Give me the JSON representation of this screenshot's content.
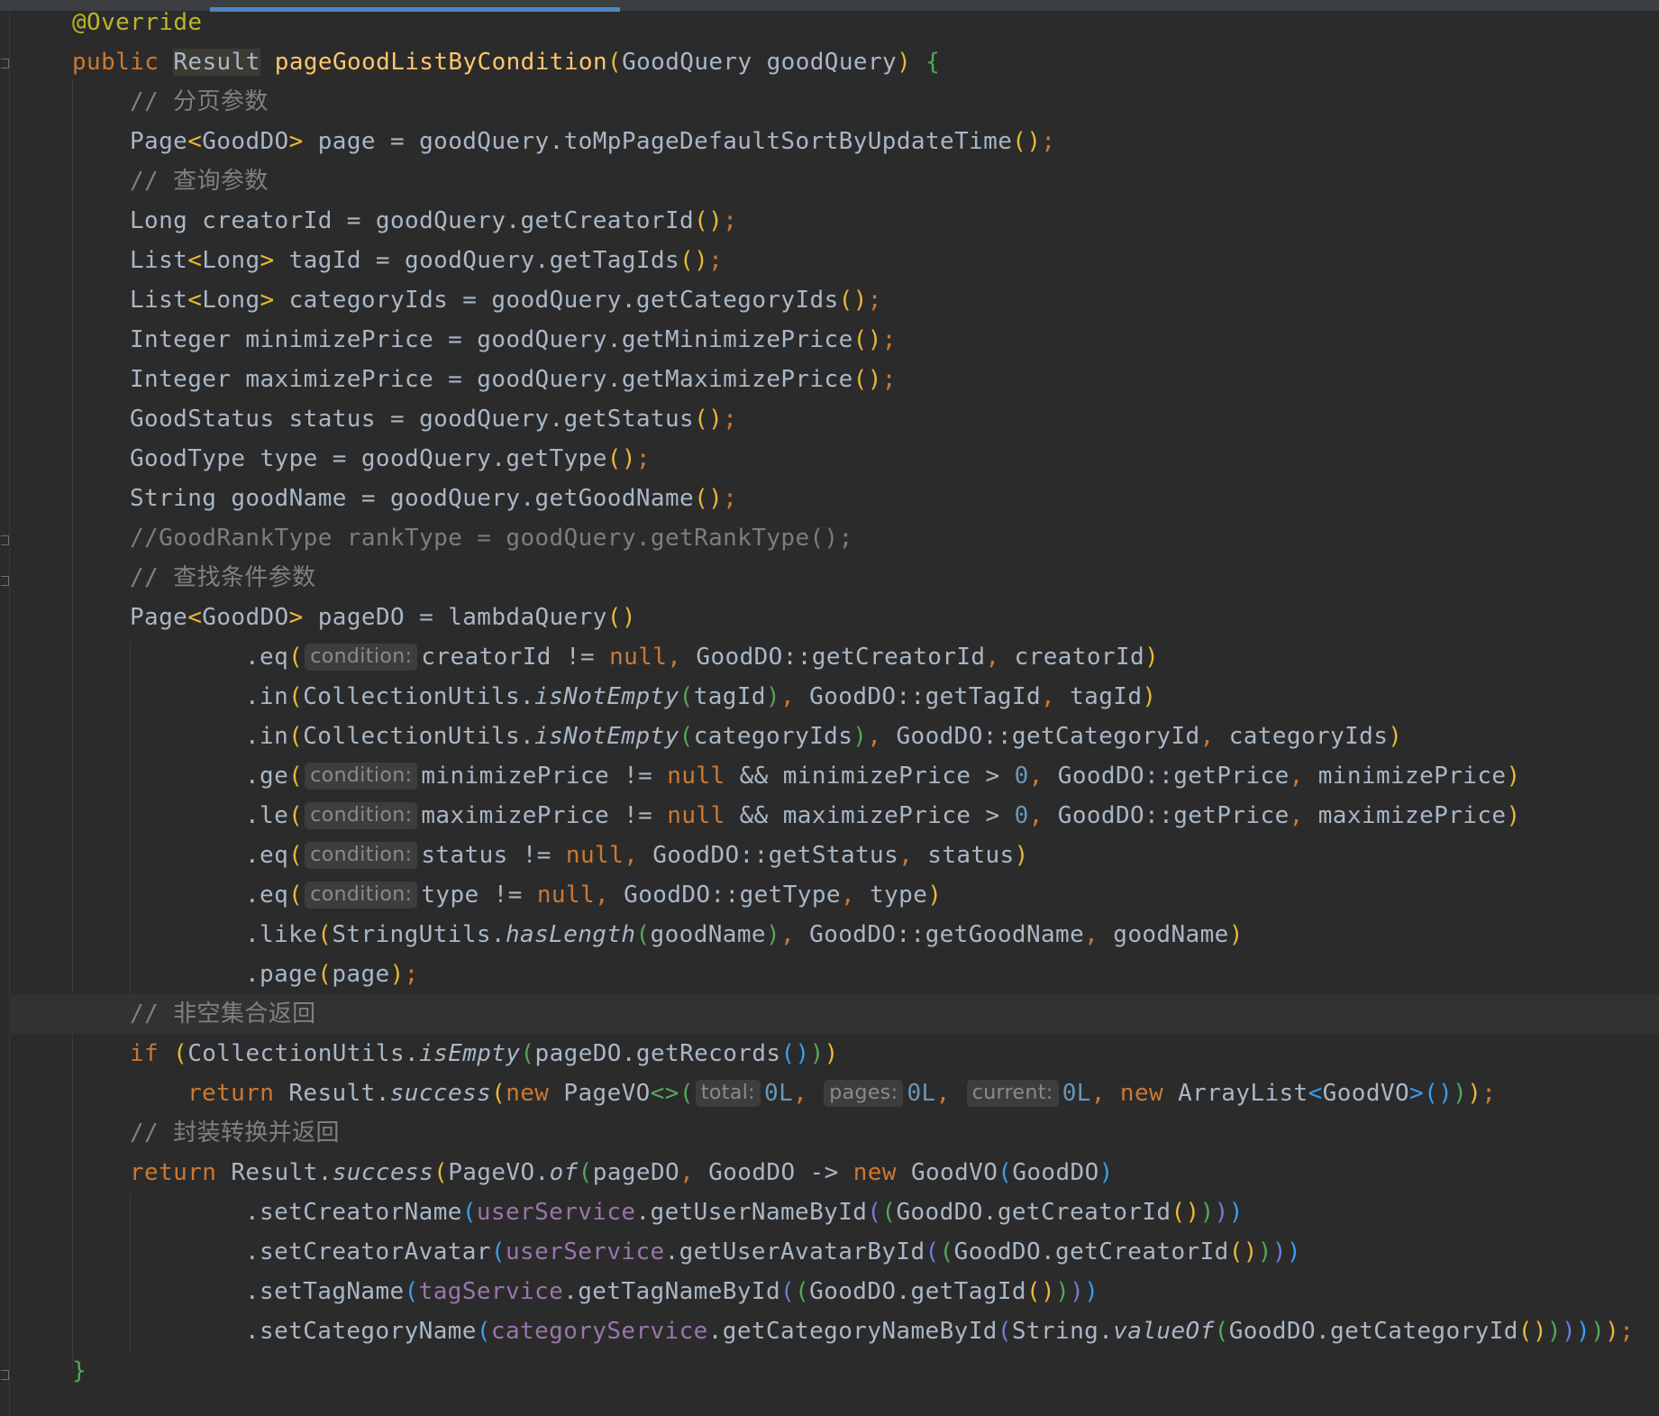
{
  "lines": [
    {
      "i": 0,
      "tokens": [
        {
          "t": "@Override",
          "c": "ann"
        }
      ]
    },
    {
      "i": 0,
      "tokens": [
        {
          "t": "public ",
          "c": "kw"
        },
        {
          "t": "Result",
          "c": "typehl"
        },
        {
          "t": " "
        },
        {
          "t": "pageGoodListByCondition",
          "c": "fn"
        },
        {
          "t": "(",
          "c": "b1"
        },
        {
          "t": "GoodQuery goodQuery"
        },
        {
          "t": ")",
          "c": "b1"
        },
        {
          "t": " "
        },
        {
          "t": "{",
          "c": "b2"
        }
      ]
    },
    {
      "i": 1,
      "tokens": [
        {
          "t": "// 分页参数",
          "c": "cm"
        }
      ]
    },
    {
      "i": 1,
      "tokens": [
        {
          "t": "Page"
        },
        {
          "t": "<",
          "c": "b1"
        },
        {
          "t": "GoodDO"
        },
        {
          "t": ">",
          "c": "b1"
        },
        {
          "t": " page = goodQuery.toMpPageDefaultSortByUpdateTime"
        },
        {
          "t": "()",
          "c": "b1"
        },
        {
          "t": ";",
          "c": "pun"
        }
      ]
    },
    {
      "i": 1,
      "tokens": [
        {
          "t": "// 查询参数",
          "c": "cm"
        }
      ]
    },
    {
      "i": 1,
      "tokens": [
        {
          "t": "Long creatorId = goodQuery.getCreatorId"
        },
        {
          "t": "()",
          "c": "b1"
        },
        {
          "t": ";",
          "c": "pun"
        }
      ]
    },
    {
      "i": 1,
      "tokens": [
        {
          "t": "List"
        },
        {
          "t": "<",
          "c": "b1"
        },
        {
          "t": "Long"
        },
        {
          "t": ">",
          "c": "b1"
        },
        {
          "t": " tagId = goodQuery.getTagIds"
        },
        {
          "t": "()",
          "c": "b1"
        },
        {
          "t": ";",
          "c": "pun"
        }
      ]
    },
    {
      "i": 1,
      "tokens": [
        {
          "t": "List"
        },
        {
          "t": "<",
          "c": "b1"
        },
        {
          "t": "Long"
        },
        {
          "t": ">",
          "c": "b1"
        },
        {
          "t": " categoryIds = goodQuery.getCategoryIds"
        },
        {
          "t": "()",
          "c": "b1"
        },
        {
          "t": ";",
          "c": "pun"
        }
      ]
    },
    {
      "i": 1,
      "tokens": [
        {
          "t": "Integer minimizePrice = goodQuery.getMinimizePrice"
        },
        {
          "t": "()",
          "c": "b1"
        },
        {
          "t": ";",
          "c": "pun"
        }
      ]
    },
    {
      "i": 1,
      "tokens": [
        {
          "t": "Integer maximizePrice = goodQuery.getMaximizePrice"
        },
        {
          "t": "()",
          "c": "b1"
        },
        {
          "t": ";",
          "c": "pun"
        }
      ]
    },
    {
      "i": 1,
      "tokens": [
        {
          "t": "GoodStatus status = goodQuery.getStatus"
        },
        {
          "t": "()",
          "c": "b1"
        },
        {
          "t": ";",
          "c": "pun"
        }
      ]
    },
    {
      "i": 1,
      "tokens": [
        {
          "t": "GoodType type = goodQuery.getType"
        },
        {
          "t": "()",
          "c": "b1"
        },
        {
          "t": ";",
          "c": "pun"
        }
      ]
    },
    {
      "i": 1,
      "tokens": [
        {
          "t": "String goodName = goodQuery.getGoodName"
        },
        {
          "t": "()",
          "c": "b1"
        },
        {
          "t": ";",
          "c": "pun"
        }
      ]
    },
    {
      "i": 1,
      "tokens": [
        {
          "t": "//GoodRankType rankType = goodQuery.getRankType();",
          "c": "dim"
        }
      ]
    },
    {
      "i": 1,
      "tokens": [
        {
          "t": "// 查找条件参数",
          "c": "cm"
        }
      ]
    },
    {
      "i": 1,
      "tokens": [
        {
          "t": "Page"
        },
        {
          "t": "<",
          "c": "b1"
        },
        {
          "t": "GoodDO"
        },
        {
          "t": ">",
          "c": "b1"
        },
        {
          "t": " pageDO = lambdaQuery"
        },
        {
          "t": "()",
          "c": "b1"
        }
      ]
    },
    {
      "i": 3,
      "tokens": [
        {
          "t": ".eq"
        },
        {
          "t": "(",
          "c": "b1"
        },
        {
          "h": "condition:"
        },
        {
          "t": "creatorId != "
        },
        {
          "t": "null",
          "c": "kw"
        },
        {
          "t": ", ",
          "c": "pun"
        },
        {
          "t": "GoodDO::getCreatorId"
        },
        {
          "t": ", ",
          "c": "pun"
        },
        {
          "t": "creatorId"
        },
        {
          "t": ")",
          "c": "b1"
        }
      ]
    },
    {
      "i": 3,
      "tokens": [
        {
          "t": ".in"
        },
        {
          "t": "(",
          "c": "b1"
        },
        {
          "t": "CollectionUtils."
        },
        {
          "t": "isNotEmpty",
          "c": "it"
        },
        {
          "t": "(",
          "c": "b2"
        },
        {
          "t": "tagId"
        },
        {
          "t": ")",
          "c": "b2"
        },
        {
          "t": ", ",
          "c": "pun"
        },
        {
          "t": "GoodDO::getTagId"
        },
        {
          "t": ", ",
          "c": "pun"
        },
        {
          "t": "tagId"
        },
        {
          "t": ")",
          "c": "b1"
        }
      ]
    },
    {
      "i": 3,
      "tokens": [
        {
          "t": ".in"
        },
        {
          "t": "(",
          "c": "b1"
        },
        {
          "t": "CollectionUtils."
        },
        {
          "t": "isNotEmpty",
          "c": "it"
        },
        {
          "t": "(",
          "c": "b2"
        },
        {
          "t": "categoryIds"
        },
        {
          "t": ")",
          "c": "b2"
        },
        {
          "t": ", ",
          "c": "pun"
        },
        {
          "t": "GoodDO::getCategoryId"
        },
        {
          "t": ", ",
          "c": "pun"
        },
        {
          "t": "categoryIds"
        },
        {
          "t": ")",
          "c": "b1"
        }
      ]
    },
    {
      "i": 3,
      "tokens": [
        {
          "t": ".ge"
        },
        {
          "t": "(",
          "c": "b1"
        },
        {
          "h": "condition:"
        },
        {
          "t": "minimizePrice != "
        },
        {
          "t": "null",
          "c": "kw"
        },
        {
          "t": " && minimizePrice > "
        },
        {
          "t": "0",
          "c": "num"
        },
        {
          "t": ", ",
          "c": "pun"
        },
        {
          "t": "GoodDO::getPrice"
        },
        {
          "t": ", ",
          "c": "pun"
        },
        {
          "t": "minimizePrice"
        },
        {
          "t": ")",
          "c": "b1"
        }
      ]
    },
    {
      "i": 3,
      "tokens": [
        {
          "t": ".le"
        },
        {
          "t": "(",
          "c": "b1"
        },
        {
          "h": "condition:"
        },
        {
          "t": "maximizePrice != "
        },
        {
          "t": "null",
          "c": "kw"
        },
        {
          "t": " && maximizePrice > "
        },
        {
          "t": "0",
          "c": "num"
        },
        {
          "t": ", ",
          "c": "pun"
        },
        {
          "t": "GoodDO::getPrice"
        },
        {
          "t": ", ",
          "c": "pun"
        },
        {
          "t": "maximizePrice"
        },
        {
          "t": ")",
          "c": "b1"
        }
      ]
    },
    {
      "i": 3,
      "tokens": [
        {
          "t": ".eq"
        },
        {
          "t": "(",
          "c": "b1"
        },
        {
          "h": "condition:"
        },
        {
          "t": "status != "
        },
        {
          "t": "null",
          "c": "kw"
        },
        {
          "t": ", ",
          "c": "pun"
        },
        {
          "t": "GoodDO::getStatus"
        },
        {
          "t": ", ",
          "c": "pun"
        },
        {
          "t": "status"
        },
        {
          "t": ")",
          "c": "b1"
        }
      ]
    },
    {
      "i": 3,
      "tokens": [
        {
          "t": ".eq"
        },
        {
          "t": "(",
          "c": "b1"
        },
        {
          "h": "condition:"
        },
        {
          "t": "type != "
        },
        {
          "t": "null",
          "c": "kw"
        },
        {
          "t": ", ",
          "c": "pun"
        },
        {
          "t": "GoodDO::getType"
        },
        {
          "t": ", ",
          "c": "pun"
        },
        {
          "t": "type"
        },
        {
          "t": ")",
          "c": "b1"
        }
      ]
    },
    {
      "i": 3,
      "tokens": [
        {
          "t": ".like"
        },
        {
          "t": "(",
          "c": "b1"
        },
        {
          "t": "StringUtils."
        },
        {
          "t": "hasLength",
          "c": "it"
        },
        {
          "t": "(",
          "c": "b2"
        },
        {
          "t": "goodName"
        },
        {
          "t": ")",
          "c": "b2"
        },
        {
          "t": ", ",
          "c": "pun"
        },
        {
          "t": "GoodDO::getGoodName"
        },
        {
          "t": ", ",
          "c": "pun"
        },
        {
          "t": "goodName"
        },
        {
          "t": ")",
          "c": "b1"
        }
      ]
    },
    {
      "i": 3,
      "tokens": [
        {
          "t": ".page"
        },
        {
          "t": "(",
          "c": "b1"
        },
        {
          "t": "page"
        },
        {
          "t": ")",
          "c": "b1"
        },
        {
          "t": ";",
          "c": "pun"
        }
      ]
    },
    {
      "i": 1,
      "current": true,
      "tokens": [
        {
          "t": "// 非空集合返回",
          "c": "cm"
        }
      ]
    },
    {
      "i": 1,
      "tokens": [
        {
          "t": "if ",
          "c": "kw"
        },
        {
          "t": "(",
          "c": "b1"
        },
        {
          "t": "CollectionUtils."
        },
        {
          "t": "isEmpty",
          "c": "it"
        },
        {
          "t": "(",
          "c": "b2"
        },
        {
          "t": "pageDO.getRecords"
        },
        {
          "t": "()",
          "c": "b3"
        },
        {
          "t": ")",
          "c": "b2"
        },
        {
          "t": ")",
          "c": "b1"
        }
      ]
    },
    {
      "i": 2,
      "tokens": [
        {
          "t": "return ",
          "c": "kw"
        },
        {
          "t": "Result."
        },
        {
          "t": "success",
          "c": "it"
        },
        {
          "t": "(",
          "c": "b1"
        },
        {
          "t": "new ",
          "c": "kw"
        },
        {
          "t": "PageVO"
        },
        {
          "t": "<>",
          "c": "b2"
        },
        {
          "t": "(",
          "c": "b2"
        },
        {
          "h": "total:"
        },
        {
          "t": "0L",
          "c": "num"
        },
        {
          "t": ", ",
          "c": "pun"
        },
        {
          "h": "pages:"
        },
        {
          "t": "0L",
          "c": "num"
        },
        {
          "t": ", ",
          "c": "pun"
        },
        {
          "h": "current:"
        },
        {
          "t": "0L",
          "c": "num"
        },
        {
          "t": ", ",
          "c": "pun"
        },
        {
          "t": "new ",
          "c": "kw"
        },
        {
          "t": "ArrayList"
        },
        {
          "t": "<",
          "c": "b3"
        },
        {
          "t": "GoodVO"
        },
        {
          "t": ">",
          "c": "b3"
        },
        {
          "t": "()",
          "c": "b3"
        },
        {
          "t": ")",
          "c": "b2"
        },
        {
          "t": ")",
          "c": "b1"
        },
        {
          "t": ";",
          "c": "pun"
        }
      ]
    },
    {
      "i": 1,
      "tokens": [
        {
          "t": "// 封装转换并返回",
          "c": "cm"
        }
      ]
    },
    {
      "i": 1,
      "tokens": [
        {
          "t": "return ",
          "c": "kw"
        },
        {
          "t": "Result."
        },
        {
          "t": "success",
          "c": "it"
        },
        {
          "t": "(",
          "c": "b1"
        },
        {
          "t": "PageVO."
        },
        {
          "t": "of",
          "c": "it"
        },
        {
          "t": "(",
          "c": "b2"
        },
        {
          "t": "pageDO"
        },
        {
          "t": ", ",
          "c": "pun"
        },
        {
          "t": "GoodDO -> "
        },
        {
          "t": "new ",
          "c": "kw"
        },
        {
          "t": "GoodVO"
        },
        {
          "t": "(",
          "c": "b3"
        },
        {
          "t": "GoodDO"
        },
        {
          "t": ")",
          "c": "b3"
        }
      ]
    },
    {
      "i": 3,
      "tokens": [
        {
          "t": ".setCreatorName"
        },
        {
          "t": "(",
          "c": "b3"
        },
        {
          "t": "userService",
          "c": "fld"
        },
        {
          "t": ".getUserNameById"
        },
        {
          "t": "(",
          "c": "b4"
        },
        {
          "t": "(",
          "c": "b2"
        },
        {
          "t": "GoodDO.getCreatorId"
        },
        {
          "t": "()",
          "c": "b1"
        },
        {
          "t": ")",
          "c": "b2"
        },
        {
          "t": ")",
          "c": "b4"
        },
        {
          "t": ")",
          "c": "b3"
        }
      ]
    },
    {
      "i": 3,
      "tokens": [
        {
          "t": ".setCreatorAvatar"
        },
        {
          "t": "(",
          "c": "b3"
        },
        {
          "t": "userService",
          "c": "fld"
        },
        {
          "t": ".getUserAvatarById"
        },
        {
          "t": "(",
          "c": "b4"
        },
        {
          "t": "(",
          "c": "b2"
        },
        {
          "t": "GoodDO.getCreatorId"
        },
        {
          "t": "()",
          "c": "b1"
        },
        {
          "t": ")",
          "c": "b2"
        },
        {
          "t": ")",
          "c": "b4"
        },
        {
          "t": ")",
          "c": "b3"
        }
      ]
    },
    {
      "i": 3,
      "tokens": [
        {
          "t": ".setTagName"
        },
        {
          "t": "(",
          "c": "b3"
        },
        {
          "t": "tagService",
          "c": "fld"
        },
        {
          "t": ".getTagNameById"
        },
        {
          "t": "(",
          "c": "b4"
        },
        {
          "t": "(",
          "c": "b2"
        },
        {
          "t": "GoodDO.getTagId"
        },
        {
          "t": "()",
          "c": "b1"
        },
        {
          "t": ")",
          "c": "b2"
        },
        {
          "t": ")",
          "c": "b4"
        },
        {
          "t": ")",
          "c": "b3"
        }
      ]
    },
    {
      "i": 3,
      "tokens": [
        {
          "t": ".setCategoryName"
        },
        {
          "t": "(",
          "c": "b3"
        },
        {
          "t": "categoryService",
          "c": "fld"
        },
        {
          "t": ".getCategoryNameById"
        },
        {
          "t": "(",
          "c": "b4"
        },
        {
          "t": "String."
        },
        {
          "t": "valueOf",
          "c": "it"
        },
        {
          "t": "(",
          "c": "b2"
        },
        {
          "t": "GoodDO.getCategoryId"
        },
        {
          "t": "()",
          "c": "b1"
        },
        {
          "t": ")",
          "c": "b2"
        },
        {
          "t": ")",
          "c": "b4"
        },
        {
          "t": ")",
          "c": "b3"
        },
        {
          "t": ")",
          "c": "b2"
        },
        {
          "t": ")",
          "c": "b1"
        },
        {
          "t": ";",
          "c": "pun"
        }
      ]
    },
    {
      "i": 0,
      "tokens": [
        {
          "t": "}",
          "c": "b2"
        }
      ]
    }
  ]
}
